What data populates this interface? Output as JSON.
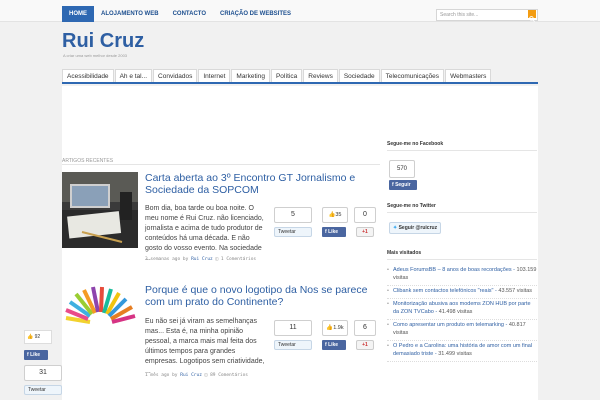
{
  "topnav": {
    "items": [
      {
        "label": "HOME",
        "active": true
      },
      {
        "label": "ALOJAMENTO WEB",
        "active": false
      },
      {
        "label": "CONTACTO",
        "active": false
      },
      {
        "label": "CRIAÇÃO DE WEBSITES",
        "active": false
      }
    ],
    "search_placeholder": "Search this site...",
    "search_icon": "search-icon"
  },
  "brand": {
    "logo": "Rui Cruz",
    "tagline": "A criar uma web melhor desde 2003"
  },
  "categories": [
    "Acessibilidade",
    "Ah e tal...",
    "Convidados",
    "Internet",
    "Marketing",
    "Política",
    "Reviews",
    "Sociedade",
    "Telecomunicações",
    "Webmasters"
  ],
  "recent_label": "ARTIGOS RECENTES",
  "posts": [
    {
      "title": "Carta aberta ao 3º Encontro GT Jornalismo e Sociedade da SOPCOM",
      "excerpt": "Bom dia, boa tarde ou boa noite. O meu nome é Rui Cruz. não licenciado, jornalista e acima de tudo produtor de conteúdos há uma década. E não gosto do vosso evento. Na sociedade ...",
      "meta_time": "3 semanas ago by",
      "meta_author": "Rui Cruz",
      "meta_comments": "1 Comentários",
      "tweets": "5",
      "likes": "35",
      "plus": "0",
      "tweet_label": "Tweetar",
      "like_label": "Like",
      "plus_label": "+1"
    },
    {
      "title": "Porque é que o novo logotipo da Nos se parece com um prato do Continente?",
      "excerpt": "Eu não sei já viram as semelhanças mas... Esta é, na minha opinião pessoal, a marca mais mal feita dos últimos tempos para grandes empresas. Logotipos sem criatividade, ...",
      "meta_time": "1 mês ago by",
      "meta_author": "Rui Cruz",
      "meta_comments": "89 Comentários",
      "tweets": "11",
      "likes": "1.9k",
      "plus": "6",
      "tweet_label": "Tweetar",
      "like_label": "Like",
      "plus_label": "+1"
    }
  ],
  "floating_share": {
    "likes": "92",
    "like_label": "Like",
    "tweets": "31",
    "tweet_label": "Tweetar"
  },
  "sidebar": {
    "facebook_title": "Segue-me no Facebook",
    "facebook_count": "570",
    "facebook_btn": "Seguir",
    "twitter_title": "Segue-me no Twitter",
    "twitter_btn": "Seguir @ruicruz",
    "popular_title": "Mais visitados",
    "popular": [
      {
        "title": "Adeus ForumsBB – 8 anos de boas recordações",
        "visits": "103.159 visitas"
      },
      {
        "title": "Clibank sem contactos telefónicos \"reais\"",
        "visits": "43.557 visitas"
      },
      {
        "title": "Monitorização abusiva aos modems ZON HUB por parte da ZON TVCabo",
        "visits": "41.498 visitas"
      },
      {
        "title": "Como apresentar um produto em telemarking",
        "visits": "40.817 visitas"
      },
      {
        "title": "O Pedro e a Carolina: uma história de amor com um final demasiado triste",
        "visits": "31.499 visitas"
      }
    ]
  },
  "colors": {
    "accent": "#2e68b2",
    "link": "#2e5fa3",
    "facebook": "#4a66a0"
  }
}
